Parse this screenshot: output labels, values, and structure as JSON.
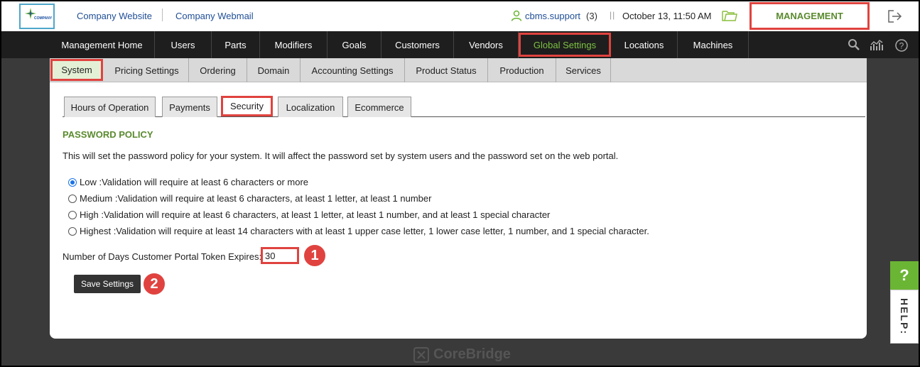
{
  "colors": {
    "accent_green": "#7cc242",
    "highlight_red": "#e0433f",
    "link_blue": "#1f4e96"
  },
  "logo": {
    "text": "COMPANY"
  },
  "topbar": {
    "links": [
      "Company Website",
      "Company Webmail"
    ],
    "user": "cbms.support",
    "user_count": "(3)",
    "datetime": "October 13, 11:50 AM",
    "management_label": "MANAGEMENT"
  },
  "mainnav": {
    "items": [
      "Management Home",
      "Users",
      "Parts",
      "Modifiers",
      "Goals",
      "Customers",
      "Vendors",
      "Global Settings",
      "Locations",
      "Machines"
    ],
    "active": "Global Settings",
    "icons": [
      "search-icon",
      "analytics-icon",
      "help-circle-icon"
    ]
  },
  "subnav": {
    "items": [
      "System",
      "Pricing Settings",
      "Ordering",
      "Domain",
      "Accounting Settings",
      "Product Status",
      "Production",
      "Services"
    ],
    "active": "System"
  },
  "tabs": {
    "items": [
      "Hours of Operation",
      "Payments",
      "Security",
      "Localization",
      "Ecommerce"
    ],
    "active": "Security"
  },
  "policy": {
    "title": "PASSWORD POLICY",
    "description": "This will set the password policy for your system. It will affect the password set by system users and the password set on the web portal.",
    "options": [
      "Low :Validation will require at least 6 characters or more",
      "Medium :Validation will require at least 6 characters, at least 1 letter, at least 1 number",
      "High :Validation will require at least 6 characters, at least 1 letter, at least 1 number, and at least 1 special character",
      "Highest :Validation will require at least 14 characters with at least 1 upper case letter, 1 lower case letter, 1 number, and 1 special character."
    ],
    "selected_index": 0
  },
  "token": {
    "label": "Number of Days Customer Portal Token Expires:",
    "value": "30"
  },
  "save_label": "Save Settings",
  "annotations": {
    "step1": "1",
    "step2": "2"
  },
  "watermark": "CoreBridge",
  "help": {
    "q": "?",
    "label": "HELP:"
  }
}
